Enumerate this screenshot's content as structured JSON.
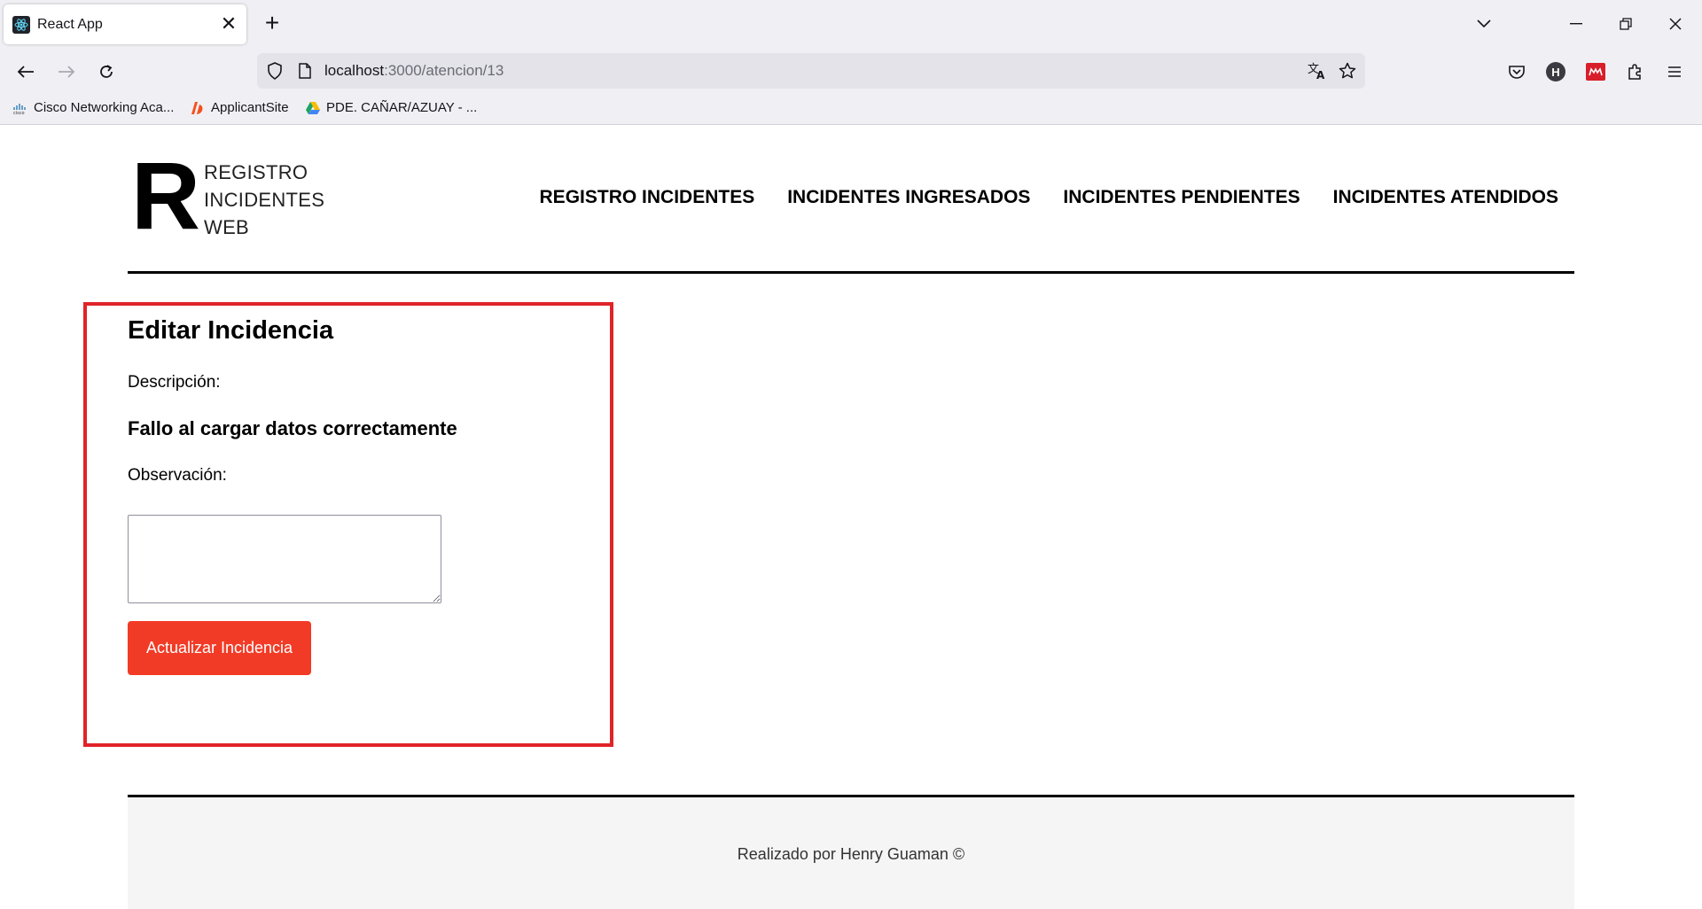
{
  "browser": {
    "tab_title": "React App",
    "tab_close": "✕",
    "new_tab": "+",
    "url_host": "localhost",
    "url_path": ":3000/atencion/13",
    "profile_letter": "H",
    "bookmarks": [
      {
        "label": "Cisco Networking Aca..."
      },
      {
        "label": "ApplicantSite"
      },
      {
        "label": "PDE. CAÑAR/AZUAY - ..."
      }
    ]
  },
  "header": {
    "logo_letter": "R",
    "logo_line1": "REGISTRO",
    "logo_line2": "INCIDENTES",
    "logo_line3": "WEB",
    "nav": [
      {
        "label": "REGISTRO INCIDENTES"
      },
      {
        "label": "INCIDENTES INGRESADOS"
      },
      {
        "label": "INCIDENTES PENDIENTES"
      },
      {
        "label": "INCIDENTES ATENDIDOS"
      }
    ]
  },
  "form": {
    "title": "Editar Incidencia",
    "description_label": "Descripción:",
    "description_value": "Fallo al cargar datos correctamente",
    "observation_label": "Observación:",
    "observation_value": "",
    "submit_label": "Actualizar Incidencia"
  },
  "footer": {
    "text": "Realizado por Henry Guaman ©"
  },
  "colors": {
    "highlight_border": "#e02329",
    "button_bg": "#f23b26",
    "footer_bg": "#f5f5f5"
  }
}
